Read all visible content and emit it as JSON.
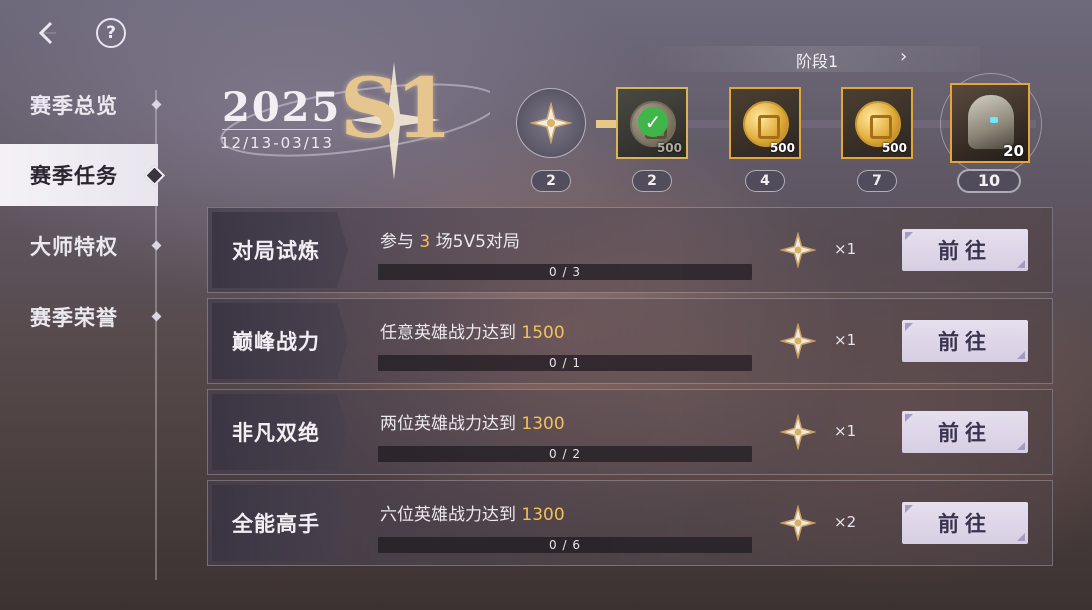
{
  "header": {
    "help_glyph": "?"
  },
  "sidebar": {
    "items": [
      {
        "label": "赛季总览"
      },
      {
        "label": "赛季任务",
        "active": true
      },
      {
        "label": "大师特权"
      },
      {
        "label": "赛季荣誉"
      }
    ]
  },
  "season": {
    "year": "2025",
    "code": "S1",
    "dates": "12/13-03/13"
  },
  "stage": {
    "label": "阶段1",
    "next_glyph": "›"
  },
  "track": {
    "start_count": "2",
    "rewards": [
      {
        "qty": "500",
        "requirement": "2",
        "claimed": true,
        "icon": "coin-icon"
      },
      {
        "qty": "500",
        "requirement": "4",
        "claimed": false,
        "icon": "coin-icon"
      },
      {
        "qty": "500",
        "requirement": "7",
        "claimed": false,
        "icon": "coin-icon"
      },
      {
        "qty": "20",
        "requirement": "10",
        "claimed": false,
        "icon": "helmet-icon"
      }
    ]
  },
  "tasks": [
    {
      "title": "对局试炼",
      "desc_pre": "参与 ",
      "desc_hl": "3",
      "desc_post": " 场5V5对局",
      "progress_text": "0 / 3",
      "progress": 0,
      "reward_mult": "×1",
      "button": "前往"
    },
    {
      "title": "巅峰战力",
      "desc_pre": "任意英雄战力达到 ",
      "desc_hl": "1500",
      "desc_post": "",
      "progress_text": "0 / 1",
      "progress": 0,
      "reward_mult": "×1",
      "button": "前往"
    },
    {
      "title": "非凡双绝",
      "desc_pre": "两位英雄战力达到 ",
      "desc_hl": "1300",
      "desc_post": "",
      "progress_text": "0 / 2",
      "progress": 0,
      "reward_mult": "×1",
      "button": "前往"
    },
    {
      "title": "全能高手",
      "desc_pre": "六位英雄战力达到 ",
      "desc_hl": "1300",
      "desc_post": "",
      "progress_text": "0 / 6",
      "progress": 0,
      "reward_mult": "×2",
      "button": "前往"
    }
  ],
  "colors": {
    "accent_gold": "#f2c15a",
    "button_bg": "#e2dbeb",
    "active_tab_bg": "#f2eff5"
  }
}
